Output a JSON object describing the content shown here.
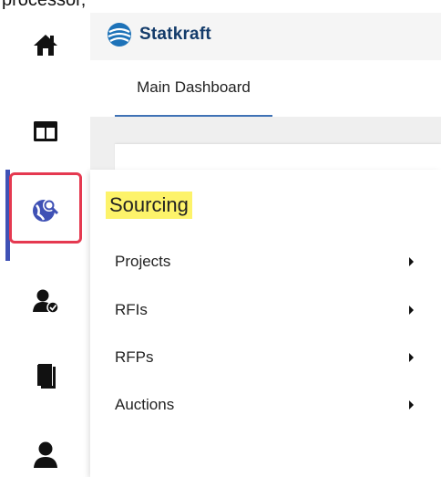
{
  "top_crop_text": "processor,",
  "header": {
    "brand_name": "Statkraft"
  },
  "tabs": [
    {
      "label": "Main Dashboard"
    }
  ],
  "rail": {
    "items": [
      {
        "name": "home-icon"
      },
      {
        "name": "dashboard-icon"
      },
      {
        "name": "sourcing-icon"
      },
      {
        "name": "user-check-icon"
      },
      {
        "name": "documents-icon"
      },
      {
        "name": "user-icon"
      }
    ]
  },
  "flyout": {
    "title": "Sourcing",
    "items": [
      {
        "label": "Projects"
      },
      {
        "label": "RFIs"
      },
      {
        "label": "RFPs"
      },
      {
        "label": "Auctions"
      }
    ]
  },
  "colors": {
    "highlight": "#fdf36a",
    "active_indicator": "#3f51b5",
    "annotation_box": "#e53950",
    "brand": "#133b6a"
  }
}
